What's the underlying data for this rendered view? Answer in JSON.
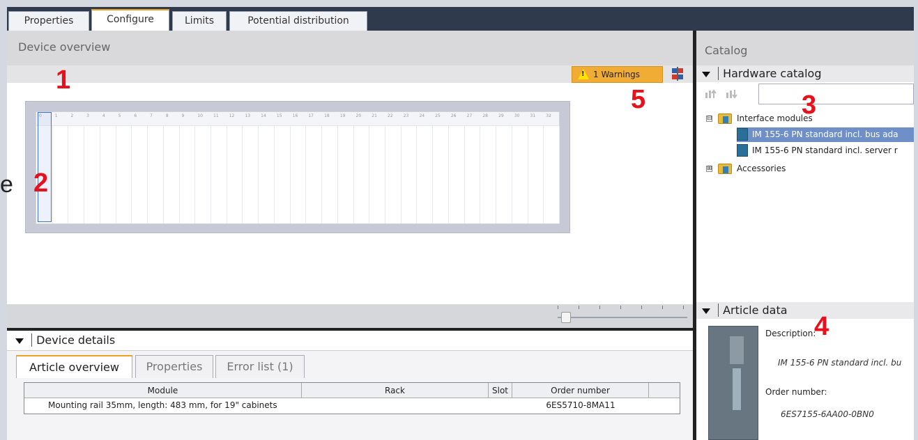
{
  "tabs": [
    {
      "label": "Properties"
    },
    {
      "label": "Configure"
    },
    {
      "label": "Limits"
    },
    {
      "label": "Potential distribution"
    }
  ],
  "device_overview": {
    "title": "Device overview",
    "warnings_label": "1 Warnings",
    "slot_numbers": [
      "0",
      "1",
      "2",
      "3",
      "4",
      "5",
      "6",
      "7",
      "8",
      "9",
      "10",
      "11",
      "12",
      "13",
      "14",
      "15",
      "16",
      "17",
      "18",
      "19",
      "20",
      "21",
      "22",
      "23",
      "24",
      "25",
      "26",
      "27",
      "28",
      "29",
      "30",
      "31",
      "32"
    ]
  },
  "device_details": {
    "title": "Device details",
    "tabs": [
      {
        "label": "Article overview"
      },
      {
        "label": "Properties"
      },
      {
        "label": "Error list (1)"
      }
    ],
    "table": {
      "columns": [
        "Module",
        "Rack",
        "Slot",
        "Order number"
      ],
      "rows": [
        {
          "module": "Mounting rail 35mm, length: 483 mm, for 19\" cabinets",
          "rack": "",
          "slot": "",
          "order_number": "6ES5710-8MA11"
        }
      ]
    }
  },
  "catalog": {
    "title": "Catalog",
    "hardware_catalog_label": "Hardware catalog",
    "search_value": "",
    "tree": [
      {
        "label": "Interface modules",
        "expander": "⊟"
      },
      {
        "label": "IM 155-6 PN standard incl. bus ada"
      },
      {
        "label": "IM 155-6 PN standard incl. server r"
      },
      {
        "label": "Accessories",
        "expander": "⊞"
      }
    ]
  },
  "article_data": {
    "title": "Article data",
    "description_label": "Description:",
    "description_value": "IM 155-6 PN standard incl. bu",
    "order_number_label": "Order number:",
    "order_number_value": "6ES7155-6AA00-0BN0"
  },
  "annotations": [
    "1",
    "2",
    "3",
    "4",
    "5"
  ],
  "stray_text": "e",
  "colors": {
    "tabstrip": "#2f3a4d",
    "accent_orange": "#f0a020",
    "warning": "#f0ac34",
    "selection": "#6f8fc8",
    "annotation_red": "#e8101a"
  }
}
